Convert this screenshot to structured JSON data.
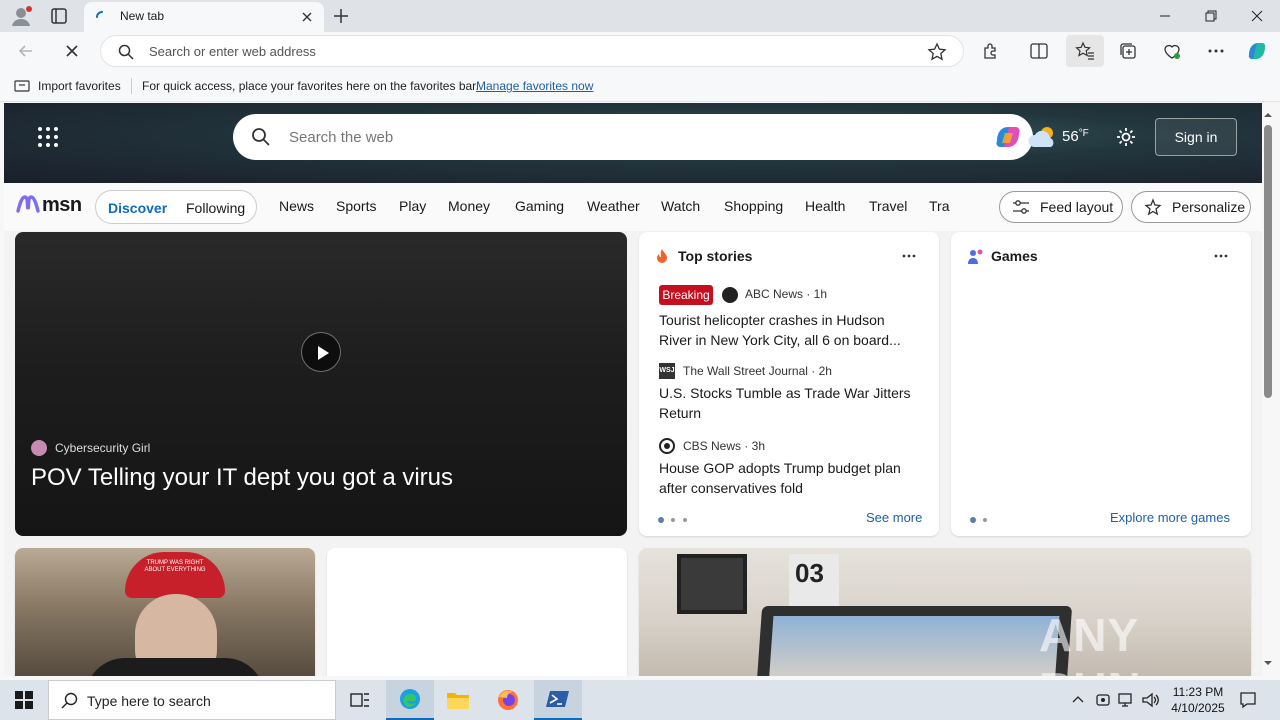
{
  "browser": {
    "tab_title": "New tab",
    "address_placeholder": "Search or enter web address"
  },
  "favorites_bar": {
    "import_label": "Import favorites",
    "message": "For quick access, place your favorites here on the favorites bar.",
    "manage_link": "Manage favorites now"
  },
  "msn": {
    "search_placeholder": "Search the web",
    "temperature": "56",
    "temperature_unit": "°F",
    "sign_in": "Sign in",
    "logo_text": "msn",
    "tabs": {
      "discover": "Discover",
      "following": "Following"
    },
    "nav": [
      "News",
      "Sports",
      "Play",
      "Money",
      "Gaming",
      "Weather",
      "Watch",
      "Shopping",
      "Health",
      "Travel",
      "Tra"
    ],
    "feed_layout": "Feed layout",
    "personalize": "Personalize"
  },
  "video_card": {
    "source": "Cybersecurity Girl",
    "title": "POV Telling your IT dept you got a virus"
  },
  "top_stories": {
    "heading": "Top stories",
    "stories": [
      {
        "badge": "Breaking",
        "source": "ABC News · 1h",
        "title_line1": "Tourist helicopter crashes in Hudson",
        "title_line2": "River in New York City, all 6 on board..."
      },
      {
        "source_logo": "WSJ",
        "source": "The Wall Street Journal · 2h",
        "title_line1": "U.S. Stocks Tumble as Trade War Jitters",
        "title_line2": "Return"
      },
      {
        "source": "CBS News · 3h",
        "title_line1": "House GOP adopts Trump budget plan",
        "title_line2": "after conservatives fold"
      }
    ],
    "see_more": "See more"
  },
  "games": {
    "heading": "Games",
    "explore": "Explore more games"
  },
  "images": {
    "hat_text": "TRUMP WAS RIGHT ABOUT EVERYTHING",
    "jersey_number": "03"
  },
  "watermark": "ANY RUN",
  "taskbar": {
    "search_placeholder": "Type here to search",
    "time": "11:23 PM",
    "date": "4/10/2025"
  },
  "colors": {
    "accent": "#0f6cbd",
    "breaking": "#c50f1f",
    "link": "#1d5fa8"
  }
}
